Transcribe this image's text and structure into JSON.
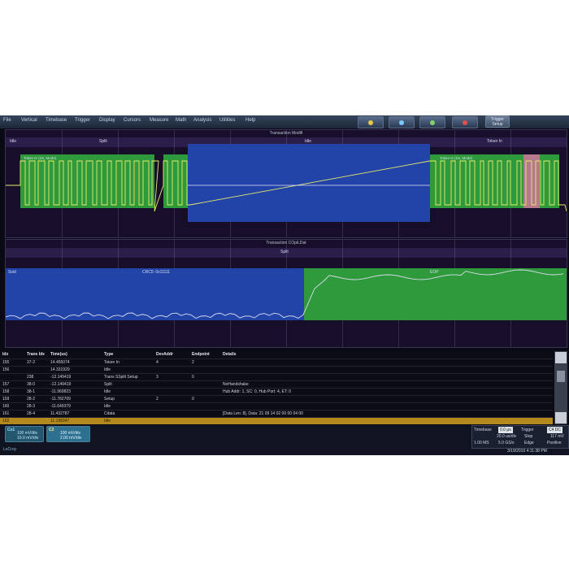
{
  "menu": [
    "File",
    "Vertical",
    "Timebase",
    "Trigger",
    "Display",
    "Cursors",
    "Measure",
    "Math",
    "Analysis",
    "Utilities",
    "Help"
  ],
  "toolbar_icons": [
    "channel-icon",
    "math-icon",
    "zoom-icon",
    "help-icon"
  ],
  "trigger_setup": {
    "line1": "Trigger",
    "line2": "Setup"
  },
  "panel1": {
    "title": "Transaction Modifi",
    "labels": {
      "idle_left": "Idle",
      "split": "Split",
      "idle_mid": "Idle",
      "token": "Token In",
      "token_green_left": "Token In (Ss, Mode)",
      "token_green_right": "Token In (Ss, Mode)"
    }
  },
  "panel2": {
    "title": "Transaction COpiLDat",
    "labels": {
      "split": "Split",
      "ssid": "Ssid",
      "crc": "CRC5: 0x11111",
      "eop": "EOP"
    }
  },
  "table": {
    "headers": [
      "Idx",
      "Trans Idx",
      "Time(us)",
      "Type",
      "DevAddr",
      "Endpoint",
      "Details"
    ],
    "rows": [
      [
        "155",
        "37-2",
        "14.455074",
        "Token In",
        "4",
        "2",
        ""
      ],
      [
        "156",
        "",
        "14.331929",
        "Idle",
        "",
        "",
        ""
      ],
      [
        "",
        "238",
        "-12.149419",
        "Trans SSplit Setup",
        "3",
        "0",
        ""
      ],
      [
        "157",
        "38-0",
        "-12.149419",
        "Split",
        "",
        "",
        "NoHandshake"
      ],
      [
        "158",
        "38-1",
        "-11.969823",
        "Idle",
        "",
        "",
        "Hub Addr: 1, SC: 0, Hub Port: 4, ET: 0"
      ],
      [
        "159",
        "28-2",
        "-11.782709",
        "Setup",
        "2",
        "0",
        ""
      ],
      [
        "160",
        "28-3",
        "-11.649379",
        "Idle",
        "",
        "",
        ""
      ],
      [
        "161",
        "28-4",
        "11.432787",
        "Cdata",
        "",
        "",
        "[Data Len: 8], Data: 21 09 14 02 00 00 04 00"
      ],
      [
        "162",
        "",
        "11.198347",
        "Idle",
        "",
        "",
        ""
      ]
    ]
  },
  "descriptors": {
    "c1": {
      "label": "Cx1",
      "line1": "100 mV/div",
      "line2": "10.0 mV/div"
    },
    "c2": {
      "label": "C2",
      "line1": "100 mV/div",
      "line2": "2.00 mV/div"
    }
  },
  "timebase": {
    "label": "Timebase",
    "value": "0.0 μs",
    "row2a": "20.0 us/div",
    "row3a": "1.00 MS",
    "row3b": "5.0 GS/s"
  },
  "trigger": {
    "label": "Trigger",
    "value": "C4 DC",
    "row2a": "Stop",
    "row2b": "117 mV",
    "row3a": "Edge",
    "row3b": "Positive"
  },
  "datetime": "3/19/2010 4:11:38 PM",
  "brand": "LeCroy"
}
